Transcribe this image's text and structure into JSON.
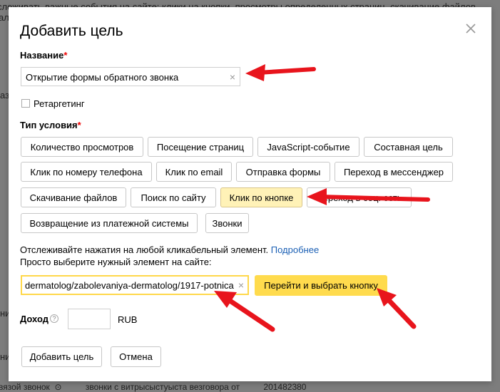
{
  "background": {
    "top_text": "слеживать важные события на сайте: клики на кнопки, просмотры определенных страниц, скачивание файлов",
    "top_text2": "ал",
    "left_fragments": [
      "аз",
      "ни",
      "ни"
    ],
    "bottom_text": "вязой звонок  ⊙          звонки с витрысыстуыста везговора от          201482380"
  },
  "modal": {
    "title": "Добавить цель",
    "name_label": "Название",
    "required_mark": "*",
    "name_value": "Открытие формы обратного звонка",
    "clear_glyph": "×",
    "retargeting_label": "Ретаргетинг",
    "condition_label": "Тип условия",
    "condition_types": [
      "Количество просмотров",
      "Посещение страниц",
      "JavaScript-событие",
      "Составная цель",
      "Клик по номеру телефона",
      "Клик по email",
      "Отправка формы",
      "Переход в мессенджер",
      "Скачивание файлов",
      "Поиск по сайту",
      "Клик по кнопке",
      "Переход в соц. сеть",
      "Возвращение из платежной системы",
      "Звонки"
    ],
    "hint_text": "Отслеживайте нажатия на любой кликабельный элемент. ",
    "hint_link": "Подробнее",
    "hint_text2": "Просто выберите нужный элемент на сайте:",
    "url_value": "dermatolog/zabolevaniya-dermatolog/1917-potnica",
    "select_button": "Перейти и выбрать кнопку",
    "income_label": "Доход",
    "help_glyph": "?",
    "currency": "RUB",
    "add_button": "Добавить цель",
    "cancel_button": "Отмена"
  },
  "colors": {
    "accent_yellow": "#ffdb4d",
    "active_button": "#fff2b7",
    "annotation_arrow": "#e8141c",
    "link": "#1a5fb4",
    "required": "#ee0000"
  }
}
